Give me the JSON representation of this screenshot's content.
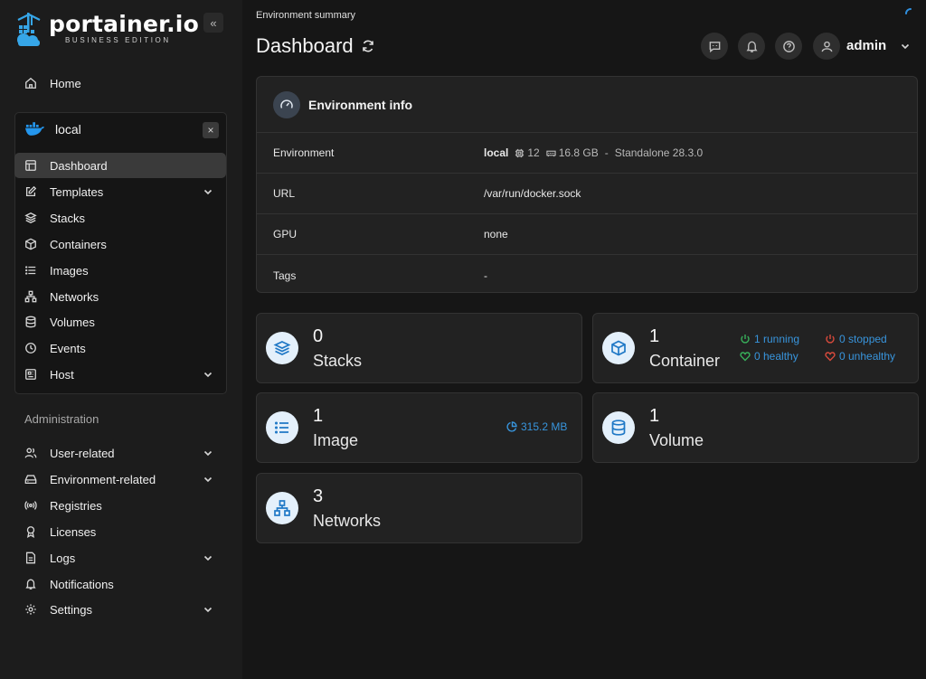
{
  "brand": {
    "name": "portainer.io",
    "edition": "BUSINESS EDITION"
  },
  "sidebar": {
    "collapse": "«",
    "home": "Home",
    "environment": {
      "name": "local",
      "close": "×",
      "items": [
        "Dashboard",
        "Templates",
        "Stacks",
        "Containers",
        "Images",
        "Networks",
        "Volumes",
        "Events",
        "Host"
      ]
    },
    "admin_label": "Administration",
    "admin_items": [
      "User-related",
      "Environment-related",
      "Registries",
      "Licenses",
      "Logs",
      "Notifications",
      "Settings"
    ]
  },
  "header": {
    "breadcrumb": "Environment summary",
    "title": "Dashboard",
    "user": "admin"
  },
  "env_info": {
    "title": "Environment info",
    "rows": {
      "environment_label": "Environment",
      "environment_name": "local",
      "cpu": "12",
      "memory": "16.8 GB",
      "sep": "-",
      "type": "Standalone 28.3.0",
      "url_label": "URL",
      "url": "/var/run/docker.sock",
      "gpu_label": "GPU",
      "gpu": "none",
      "tags_label": "Tags",
      "tags": "-"
    }
  },
  "stats": {
    "stacks": {
      "count": "0",
      "label": "Stacks"
    },
    "containers": {
      "count": "1",
      "label": "Container",
      "running": "1 running",
      "stopped": "0 stopped",
      "healthy": "0 healthy",
      "unhealthy": "0 unhealthy"
    },
    "images": {
      "count": "1",
      "label": "Image",
      "size": "315.2 MB"
    },
    "volumes": {
      "count": "1",
      "label": "Volume"
    },
    "networks": {
      "count": "3",
      "label": "Networks"
    }
  },
  "colors": {
    "accent": "#1f78c6",
    "running": "#38b15b",
    "stopped": "#d94a3c",
    "info": "#3895dd"
  }
}
